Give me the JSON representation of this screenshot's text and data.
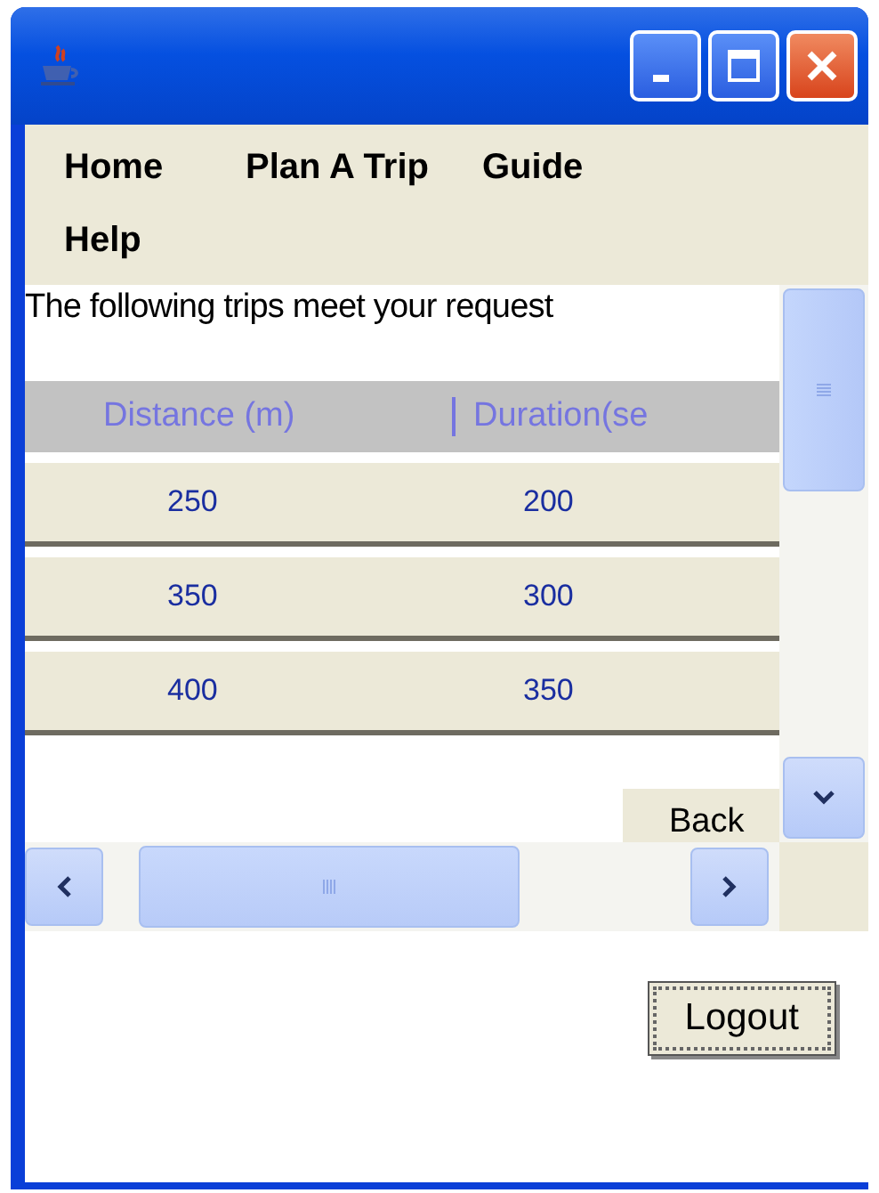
{
  "menu": [
    "Home",
    "Plan A Trip",
    "Guide",
    "Help"
  ],
  "message": "The following trips meet your request",
  "table": {
    "columns": [
      "Distance (m)",
      "Duration(se"
    ],
    "rows": [
      [
        "250",
        "200"
      ],
      [
        "350",
        "300"
      ],
      [
        "400",
        "350"
      ]
    ]
  },
  "back_button": "Back",
  "logout_button": "Logout"
}
